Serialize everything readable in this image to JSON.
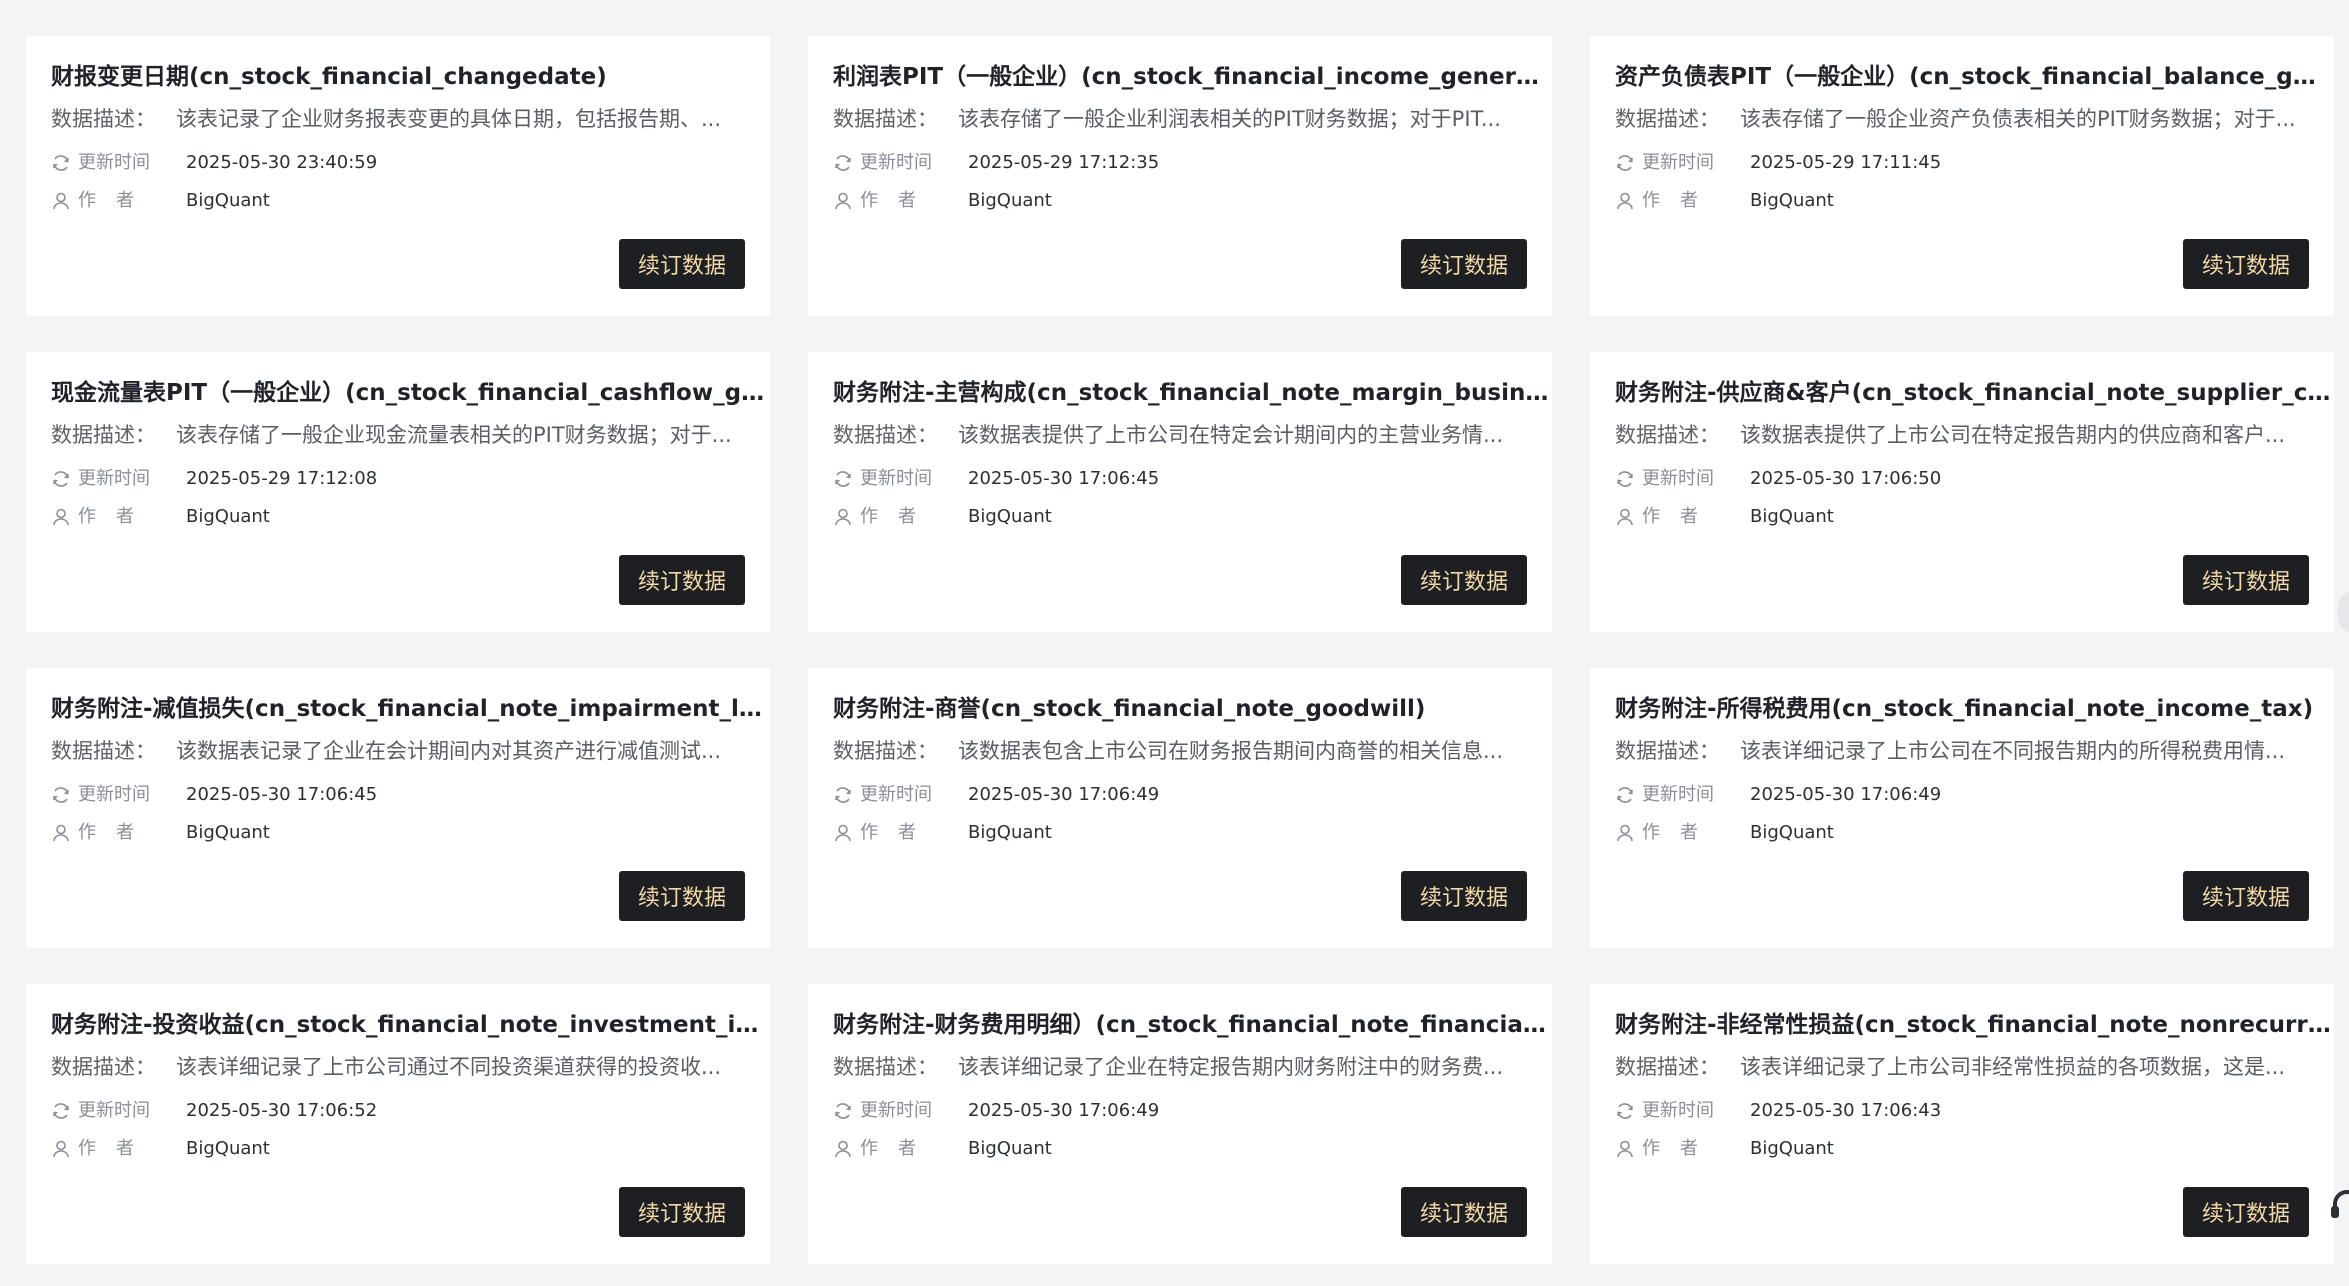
{
  "labels": {
    "desc": "数据描述：",
    "updated": "更新时间",
    "author": "作者",
    "button": "续订数据"
  },
  "icons": {
    "updated": "refresh-icon",
    "author": "user-icon",
    "support": "headset-icon"
  },
  "colors": {
    "button_bg": "#1d1f23",
    "button_text": "#f3d9a6",
    "page_bg": "#f4f4f5"
  },
  "cards": [
    {
      "title": "财报变更日期(cn_stock_financial_changedate)",
      "desc": "该表记录了企业财务报表变更的具体日期，包括报告期、...",
      "updated": "2025-05-30 23:40:59",
      "author": "BigQuant"
    },
    {
      "title": "利润表PIT（一般企业）(cn_stock_financial_income_general_pit)",
      "desc": "该表存储了一般企业利润表相关的PIT财务数据；对于PIT...",
      "updated": "2025-05-29 17:12:35",
      "author": "BigQuant"
    },
    {
      "title": "资产负债表PIT（一般企业）(cn_stock_financial_balance_gener...",
      "desc": "该表存储了一般企业资产负债表相关的PIT财务数据；对于...",
      "updated": "2025-05-29 17:11:45",
      "author": "BigQuant"
    },
    {
      "title": "现金流量表PIT（一般企业）(cn_stock_financial_cashflow_gen...",
      "desc": "该表存储了一般企业现金流量表相关的PIT财务数据；对于...",
      "updated": "2025-05-29 17:12:08",
      "author": "BigQuant"
    },
    {
      "title": "财务附注-主营构成(cn_stock_financial_note_margin_business)",
      "desc": "该数据表提供了上市公司在特定会计期间内的主营业务情...",
      "updated": "2025-05-30 17:06:45",
      "author": "BigQuant"
    },
    {
      "title": "财务附注-供应商&客户(cn_stock_financial_note_supplier_cust...",
      "desc": "该数据表提供了上市公司在特定报告期内的供应商和客户...",
      "updated": "2025-05-30 17:06:50",
      "author": "BigQuant"
    },
    {
      "title": "财务附注-减值损失(cn_stock_financial_note_impairment_loss)",
      "desc": "该数据表记录了企业在会计期间内对其资产进行减值测试...",
      "updated": "2025-05-30 17:06:45",
      "author": "BigQuant"
    },
    {
      "title": "财务附注-商誉(cn_stock_financial_note_goodwill)",
      "desc": "该数据表包含上市公司在财务报告期间内商誉的相关信息...",
      "updated": "2025-05-30 17:06:49",
      "author": "BigQuant"
    },
    {
      "title": "财务附注-所得税费用(cn_stock_financial_note_income_tax)",
      "desc": "该表详细记录了上市公司在不同报告期内的所得税费用情...",
      "updated": "2025-05-30 17:06:49",
      "author": "BigQuant"
    },
    {
      "title": "财务附注-投资收益(cn_stock_financial_note_investment_inco...",
      "desc": "该表详细记录了上市公司通过不同投资渠道获得的投资收...",
      "updated": "2025-05-30 17:06:52",
      "author": "BigQuant"
    },
    {
      "title": "财务附注-财务费用明细）(cn_stock_financial_note_financial_e...",
      "desc": "该表详细记录了企业在特定报告期内财务附注中的财务费...",
      "updated": "2025-05-30 17:06:49",
      "author": "BigQuant"
    },
    {
      "title": "财务附注-非经常性损益(cn_stock_financial_note_nonrecurring...",
      "desc": "该表详细记录了上市公司非经常性损益的各项数据，这是...",
      "updated": "2025-05-30 17:06:43",
      "author": "BigQuant"
    }
  ]
}
